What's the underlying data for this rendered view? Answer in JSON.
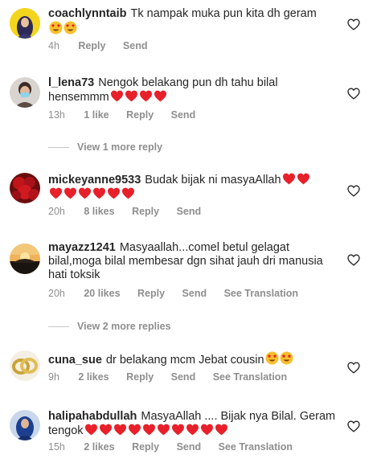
{
  "comments": [
    {
      "username": "coachlynntaib",
      "text": "Tk nampak muka pun kita dh geram",
      "emoji": "😍😍",
      "time": "4h",
      "likes": "",
      "actions": [
        "Reply",
        "Send"
      ]
    },
    {
      "username": "l_lena73",
      "text": "Nengok belakang pun dh tahu bilal hensemmm",
      "emoji": "❤❤❤❤",
      "time": "13h",
      "likes": "1 like",
      "actions": [
        "Reply",
        "Send"
      ]
    },
    {
      "username": "mickeyanne9533",
      "text": "Budak bijak ni masyaAllah",
      "emoji": "❤❤❤❤❤❤❤❤",
      "time": "20h",
      "likes": "8 likes",
      "actions": [
        "Reply",
        "Send"
      ]
    },
    {
      "username": "mayazz1241",
      "text": "Masyaallah...comel betul gelagat bilal,moga bilal membesar dgn sihat jauh dri manusia hati toksik",
      "emoji": "",
      "time": "20h",
      "likes": "20 likes",
      "actions": [
        "Reply",
        "Send",
        "See Translation"
      ]
    },
    {
      "username": "cuna_sue",
      "text": "dr belakang mcm Jebat cousin",
      "emoji": "🤩🤩",
      "time": "9h",
      "likes": "2 likes",
      "actions": [
        "Reply",
        "Send",
        "See Translation"
      ]
    },
    {
      "username": "halipahabdullah",
      "text": "MasyaAllah .... Bijak nya Bilal. Geram tengok",
      "emoji": "❤❤❤❤❤❤❤❤❤❤",
      "time": "15h",
      "likes": "2 likes",
      "actions": [
        "Reply",
        "Send",
        "See Translation"
      ]
    }
  ],
  "view_replies": [
    {
      "label": "View 1 more reply"
    },
    {
      "label": "View 2 more replies"
    }
  ],
  "icons": {
    "like": "heart-outline-icon",
    "emoji_heart": "red-heart-emoji"
  },
  "colors": {
    "text": "#262626",
    "secondary": "#8e8e8e",
    "heart_emoji": "#e8202a"
  }
}
